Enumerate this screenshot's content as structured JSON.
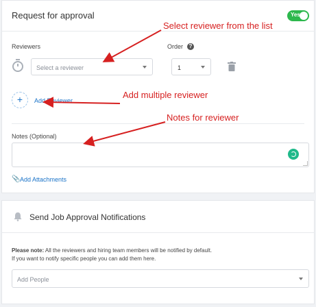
{
  "approval": {
    "title": "Request for approval",
    "toggle_label": "Yes",
    "reviewers_label": "Reviewers",
    "reviewer_placeholder": "Select a reviewer",
    "order_label": "Order",
    "order_value": "1",
    "add_reviewer": "Add Reviewer",
    "notes_label": "Notes (Optional)",
    "notes_value": "",
    "add_attachments": "Add Attachments"
  },
  "notifications": {
    "title": "Send Job Approval Notifications",
    "note_bold": "Please note:",
    "note_text": " All the reviewers and hiring team members will be notified by default.",
    "note_line2": "If you want to notify specific people you can add them here.",
    "people_placeholder": "Add People"
  },
  "annotations": {
    "select_reviewer": "Select reviewer from the list",
    "add_multiple": "Add multiple reviewer",
    "notes_for_reviewer": "Notes for reviewer"
  },
  "colors": {
    "toggle_on": "#2db84d",
    "link": "#1a73c8",
    "annotation": "#d62020",
    "emoji_button": "#1fb98a"
  }
}
